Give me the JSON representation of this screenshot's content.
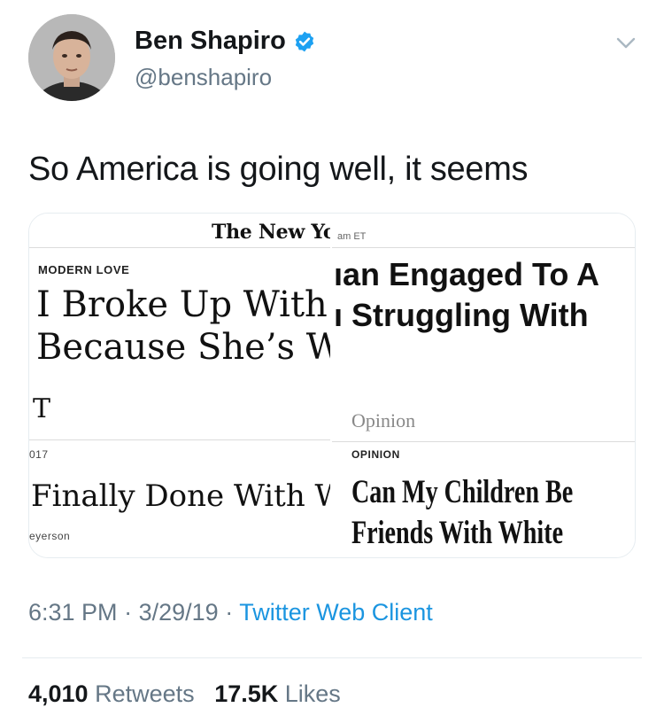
{
  "author": {
    "display_name": "Ben Shapiro",
    "handle": "@benshapiro"
  },
  "icons": {
    "verified": "verified-badge-icon",
    "menu": "chevron-down-icon"
  },
  "colors": {
    "link": "#1b95e0",
    "verified": "#1da1f2",
    "muted": "#657786",
    "text": "#14171a"
  },
  "tweet": {
    "text": "So America is going well, it seems"
  },
  "media": {
    "tile1": {
      "masthead": "The New York",
      "kicker": "MODERN LOVE",
      "headline_line1": "I Broke Up With",
      "headline_line2": "Because She’s W"
    },
    "tile2": {
      "timestamp": "am ET",
      "headline_line1": "ıan Engaged To A",
      "headline_line2": "ı Struggling With"
    },
    "tile3": {
      "top_letter": "T",
      "date": "017",
      "headline": "Finally Done With W",
      "byline": "eyerson"
    },
    "tile4": {
      "section": "Opinion",
      "kicker": "OPINION",
      "headline_line1": "Can My Children Be",
      "headline_line2": "Friends With White"
    }
  },
  "meta": {
    "time": "6:31 PM",
    "date": "3/29/19",
    "separator": "·",
    "source": "Twitter Web Client"
  },
  "stats": {
    "retweets_count": "4,010",
    "retweets_label": "Retweets",
    "likes_count": "17.5K",
    "likes_label": "Likes"
  }
}
